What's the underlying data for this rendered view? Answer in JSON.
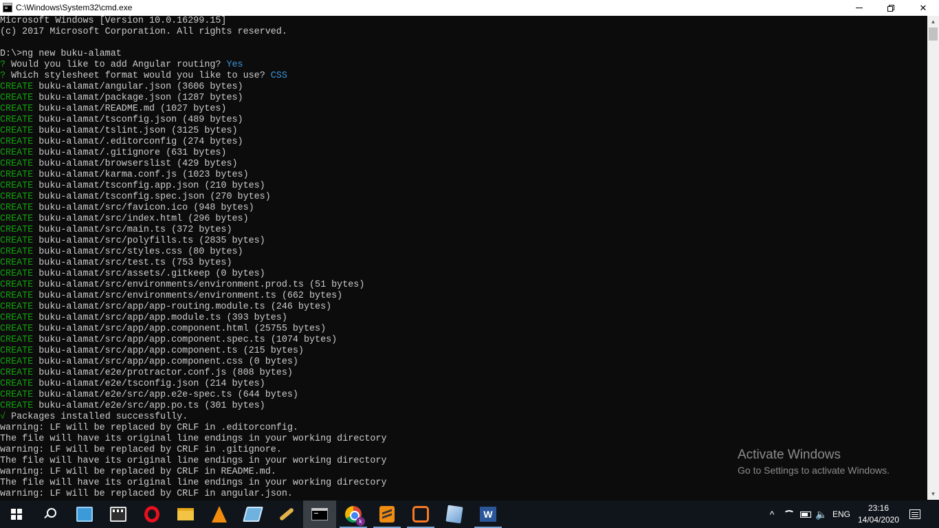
{
  "window": {
    "title": "C:\\Windows\\System32\\cmd.exe",
    "controls": [
      "minimize",
      "restore",
      "close"
    ]
  },
  "console": {
    "lines": [
      [
        {
          "t": "Microsoft Windows [Version 10.0.16299.15]",
          "c": "white"
        }
      ],
      [
        {
          "t": "(c) 2017 Microsoft Corporation. All rights reserved.",
          "c": "white"
        }
      ],
      [
        {
          "t": "",
          "c": "white"
        }
      ],
      [
        {
          "t": "D:\\>ng new buku-alamat",
          "c": "white"
        }
      ],
      [
        {
          "t": "?",
          "c": "green"
        },
        {
          "t": " Would you like to add Angular routing? ",
          "c": "white"
        },
        {
          "t": "Yes",
          "c": "blue"
        }
      ],
      [
        {
          "t": "?",
          "c": "green"
        },
        {
          "t": " Which stylesheet format would you like to use? ",
          "c": "white"
        },
        {
          "t": "CSS",
          "c": "blue"
        }
      ],
      [
        {
          "t": "CREATE",
          "c": "green"
        },
        {
          "t": " buku-alamat/angular.json (3606 bytes)",
          "c": "white"
        }
      ],
      [
        {
          "t": "CREATE",
          "c": "green"
        },
        {
          "t": " buku-alamat/package.json (1287 bytes)",
          "c": "white"
        }
      ],
      [
        {
          "t": "CREATE",
          "c": "green"
        },
        {
          "t": " buku-alamat/README.md (1027 bytes)",
          "c": "white"
        }
      ],
      [
        {
          "t": "CREATE",
          "c": "green"
        },
        {
          "t": " buku-alamat/tsconfig.json (489 bytes)",
          "c": "white"
        }
      ],
      [
        {
          "t": "CREATE",
          "c": "green"
        },
        {
          "t": " buku-alamat/tslint.json (3125 bytes)",
          "c": "white"
        }
      ],
      [
        {
          "t": "CREATE",
          "c": "green"
        },
        {
          "t": " buku-alamat/.editorconfig (274 bytes)",
          "c": "white"
        }
      ],
      [
        {
          "t": "CREATE",
          "c": "green"
        },
        {
          "t": " buku-alamat/.gitignore (631 bytes)",
          "c": "white"
        }
      ],
      [
        {
          "t": "CREATE",
          "c": "green"
        },
        {
          "t": " buku-alamat/browserslist (429 bytes)",
          "c": "white"
        }
      ],
      [
        {
          "t": "CREATE",
          "c": "green"
        },
        {
          "t": " buku-alamat/karma.conf.js (1023 bytes)",
          "c": "white"
        }
      ],
      [
        {
          "t": "CREATE",
          "c": "green"
        },
        {
          "t": " buku-alamat/tsconfig.app.json (210 bytes)",
          "c": "white"
        }
      ],
      [
        {
          "t": "CREATE",
          "c": "green"
        },
        {
          "t": " buku-alamat/tsconfig.spec.json (270 bytes)",
          "c": "white"
        }
      ],
      [
        {
          "t": "CREATE",
          "c": "green"
        },
        {
          "t": " buku-alamat/src/favicon.ico (948 bytes)",
          "c": "white"
        }
      ],
      [
        {
          "t": "CREATE",
          "c": "green"
        },
        {
          "t": " buku-alamat/src/index.html (296 bytes)",
          "c": "white"
        }
      ],
      [
        {
          "t": "CREATE",
          "c": "green"
        },
        {
          "t": " buku-alamat/src/main.ts (372 bytes)",
          "c": "white"
        }
      ],
      [
        {
          "t": "CREATE",
          "c": "green"
        },
        {
          "t": " buku-alamat/src/polyfills.ts (2835 bytes)",
          "c": "white"
        }
      ],
      [
        {
          "t": "CREATE",
          "c": "green"
        },
        {
          "t": " buku-alamat/src/styles.css (80 bytes)",
          "c": "white"
        }
      ],
      [
        {
          "t": "CREATE",
          "c": "green"
        },
        {
          "t": " buku-alamat/src/test.ts (753 bytes)",
          "c": "white"
        }
      ],
      [
        {
          "t": "CREATE",
          "c": "green"
        },
        {
          "t": " buku-alamat/src/assets/.gitkeep (0 bytes)",
          "c": "white"
        }
      ],
      [
        {
          "t": "CREATE",
          "c": "green"
        },
        {
          "t": " buku-alamat/src/environments/environment.prod.ts (51 bytes)",
          "c": "white"
        }
      ],
      [
        {
          "t": "CREATE",
          "c": "green"
        },
        {
          "t": " buku-alamat/src/environments/environment.ts (662 bytes)",
          "c": "white"
        }
      ],
      [
        {
          "t": "CREATE",
          "c": "green"
        },
        {
          "t": " buku-alamat/src/app/app-routing.module.ts (246 bytes)",
          "c": "white"
        }
      ],
      [
        {
          "t": "CREATE",
          "c": "green"
        },
        {
          "t": " buku-alamat/src/app/app.module.ts (393 bytes)",
          "c": "white"
        }
      ],
      [
        {
          "t": "CREATE",
          "c": "green"
        },
        {
          "t": " buku-alamat/src/app/app.component.html (25755 bytes)",
          "c": "white"
        }
      ],
      [
        {
          "t": "CREATE",
          "c": "green"
        },
        {
          "t": " buku-alamat/src/app/app.component.spec.ts (1074 bytes)",
          "c": "white"
        }
      ],
      [
        {
          "t": "CREATE",
          "c": "green"
        },
        {
          "t": " buku-alamat/src/app/app.component.ts (215 bytes)",
          "c": "white"
        }
      ],
      [
        {
          "t": "CREATE",
          "c": "green"
        },
        {
          "t": " buku-alamat/src/app/app.component.css (0 bytes)",
          "c": "white"
        }
      ],
      [
        {
          "t": "CREATE",
          "c": "green"
        },
        {
          "t": " buku-alamat/e2e/protractor.conf.js (808 bytes)",
          "c": "white"
        }
      ],
      [
        {
          "t": "CREATE",
          "c": "green"
        },
        {
          "t": " buku-alamat/e2e/tsconfig.json (214 bytes)",
          "c": "white"
        }
      ],
      [
        {
          "t": "CREATE",
          "c": "green"
        },
        {
          "t": " buku-alamat/e2e/src/app.e2e-spec.ts (644 bytes)",
          "c": "white"
        }
      ],
      [
        {
          "t": "CREATE",
          "c": "green"
        },
        {
          "t": " buku-alamat/e2e/src/app.po.ts (301 bytes)",
          "c": "white"
        }
      ],
      [
        {
          "t": "√",
          "c": "green"
        },
        {
          "t": " Packages installed successfully.",
          "c": "white"
        }
      ],
      [
        {
          "t": "warning: LF will be replaced by CRLF in .editorconfig.",
          "c": "white"
        }
      ],
      [
        {
          "t": "The file will have its original line endings in your working directory",
          "c": "white"
        }
      ],
      [
        {
          "t": "warning: LF will be replaced by CRLF in .gitignore.",
          "c": "white"
        }
      ],
      [
        {
          "t": "The file will have its original line endings in your working directory",
          "c": "white"
        }
      ],
      [
        {
          "t": "warning: LF will be replaced by CRLF in README.md.",
          "c": "white"
        }
      ],
      [
        {
          "t": "The file will have its original line endings in your working directory",
          "c": "white"
        }
      ],
      [
        {
          "t": "warning: LF will be replaced by CRLF in angular.json.",
          "c": "white"
        }
      ]
    ]
  },
  "colors": {
    "white": "#cccccc",
    "green": "#13a10e",
    "blue": "#3a96dd",
    "background": "#0c0c0c",
    "taskbar": "#10151c"
  },
  "watermark": {
    "title": "Activate Windows",
    "subtitle": "Go to Settings to activate Windows."
  },
  "taskbar": {
    "items": [
      {
        "name": "start-button",
        "icon": "windows-logo-icon"
      },
      {
        "name": "search-button",
        "icon": "search-icon"
      },
      {
        "name": "taskbar-app-desktop",
        "icon": "desktop-app-icon"
      },
      {
        "name": "taskbar-app-movie-maker",
        "icon": "clapperboard-icon"
      },
      {
        "name": "taskbar-app-opera",
        "icon": "opera-icon"
      },
      {
        "name": "taskbar-app-file-explorer",
        "icon": "folder-icon"
      },
      {
        "name": "taskbar-app-vlc",
        "icon": "vlc-cone-icon"
      },
      {
        "name": "taskbar-app-notepad",
        "icon": "notepad-icon"
      },
      {
        "name": "taskbar-app-tool",
        "icon": "wand-icon"
      },
      {
        "name": "taskbar-app-cmd",
        "icon": "cmd-icon"
      },
      {
        "name": "taskbar-app-chrome",
        "icon": "chrome-icon"
      },
      {
        "name": "taskbar-app-sublime",
        "icon": "sublime-icon"
      },
      {
        "name": "taskbar-app-xampp",
        "icon": "xampp-icon"
      },
      {
        "name": "taskbar-app-virtualbox",
        "icon": "virtualbox-icon"
      },
      {
        "name": "taskbar-app-word",
        "icon": "word-icon"
      }
    ],
    "chrome_badge": "k",
    "word_letter": "W",
    "tray": {
      "chevron": "^",
      "language": "ENG",
      "time": "23:16",
      "date": "14/04/2020"
    }
  }
}
